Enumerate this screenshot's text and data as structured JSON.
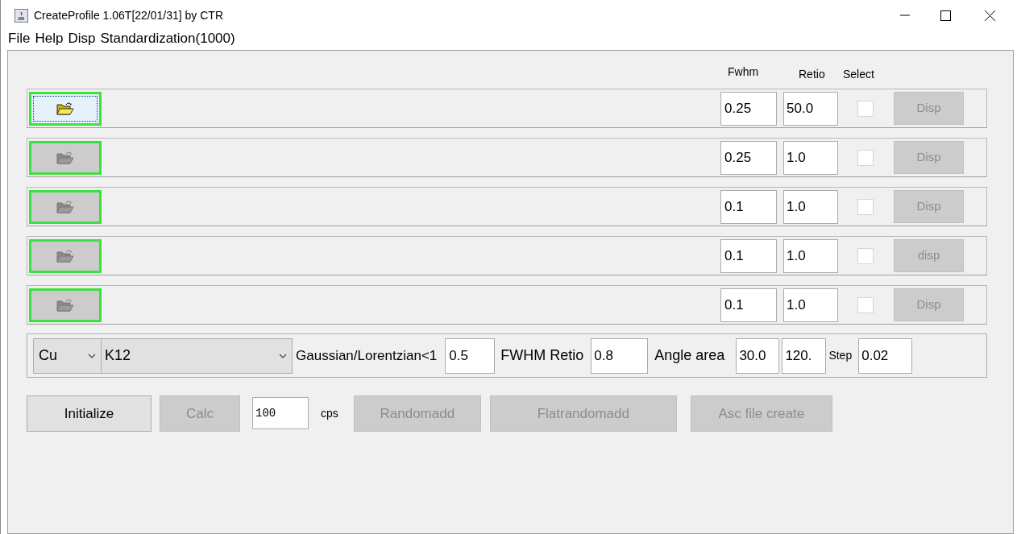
{
  "window": {
    "title": "CreateProfile 1.06T[22/01/31] by CTR"
  },
  "menu": [
    "File",
    "Help",
    "Disp",
    "Standardization(1000)"
  ],
  "columns": {
    "fwhm": "Fwhm",
    "retio": "Retio",
    "select": "Select"
  },
  "rows": [
    {
      "open_disabled": false,
      "fwhm": "0.25",
      "retio": "50.0",
      "checked": false,
      "button": "Disp",
      "button_disabled": true
    },
    {
      "open_disabled": true,
      "fwhm": "0.25",
      "retio": "1.0",
      "checked": false,
      "button": "Disp",
      "button_disabled": true
    },
    {
      "open_disabled": true,
      "fwhm": "0.1",
      "retio": "1.0",
      "checked": false,
      "button": "Disp",
      "button_disabled": true
    },
    {
      "open_disabled": true,
      "fwhm": "0.1",
      "retio": "1.0",
      "checked": false,
      "button": "disp",
      "button_disabled": true
    },
    {
      "open_disabled": true,
      "fwhm": "0.1",
      "retio": "1.0",
      "checked": false,
      "button": "Disp",
      "button_disabled": true
    }
  ],
  "settings": {
    "element": "Cu",
    "line": "K12",
    "ratio_label": "Gaussian/Lorentzian<1",
    "ratio": "0.5",
    "fwhm_label": "FWHM Retio",
    "fwhm": "0.8",
    "angle_label": "Angle area",
    "angle_from": "30.0",
    "angle_to": "120.",
    "step_label": "Step",
    "step": "0.02"
  },
  "actions": [
    {
      "kind": "button",
      "label": "Initialize",
      "disabled": false
    },
    {
      "kind": "button",
      "label": "Calc",
      "disabled": true
    },
    {
      "kind": "field",
      "value": "100"
    },
    {
      "kind": "label",
      "label": "cps"
    },
    {
      "kind": "button",
      "label": "Randomadd",
      "disabled": true
    },
    {
      "kind": "button",
      "label": "Flatrandomadd",
      "disabled": true
    },
    {
      "kind": "button",
      "label": "Asc file create",
      "disabled": true
    }
  ]
}
